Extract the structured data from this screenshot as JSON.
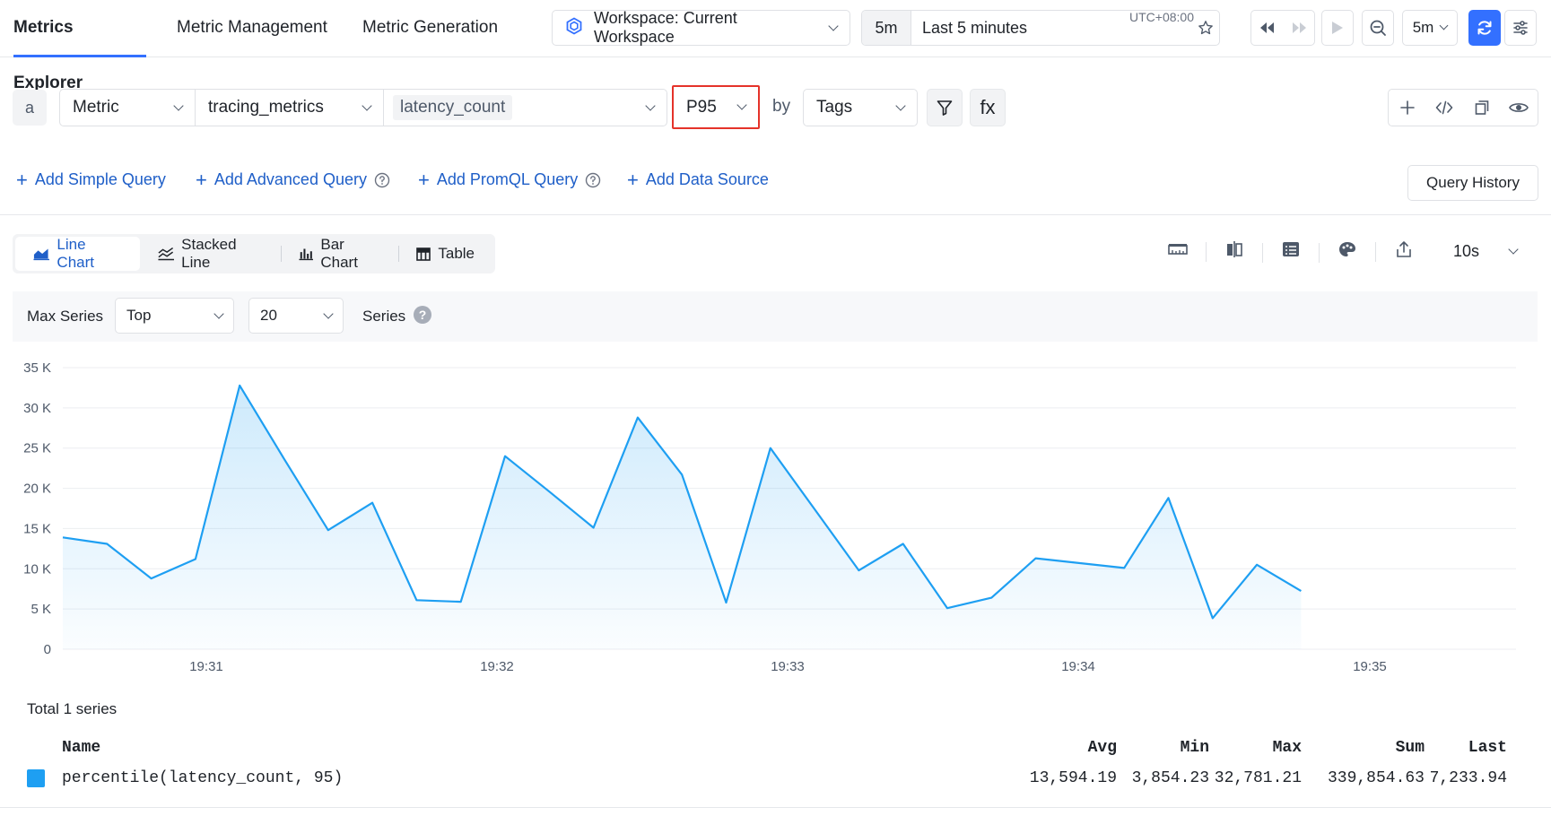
{
  "nav": {
    "tabs": [
      "Metrics Explorer",
      "Metric Management",
      "Metric Generation"
    ],
    "active_tab": "Metrics Explorer"
  },
  "toolbar": {
    "workspace_label": "Workspace: Current Workspace",
    "time_preset": "5m",
    "time_range": "Last 5 minutes",
    "timezone": "UTC+08:00",
    "refresh_interval": "5m",
    "accent_color": "#3370ff"
  },
  "query": {
    "letter": "a",
    "source_type": "Metric",
    "metric_group": "tracing_metrics",
    "metric_name": "latency_count",
    "aggregation": "P95",
    "by_label": "by",
    "group_by": "Tags",
    "fx_label": "fx",
    "highlight_color": "#e5332a"
  },
  "add_links": {
    "simple": "Add Simple Query",
    "advanced": "Add Advanced Query",
    "promql": "Add PromQL Query",
    "datasource": "Add Data Source",
    "history": "Query History"
  },
  "chart_types": {
    "line": "Line Chart",
    "stacked": "Stacked Line",
    "bar": "Bar Chart",
    "table": "Table",
    "active": "Line Chart"
  },
  "step": "10s",
  "options": {
    "max_series_label": "Max Series",
    "order": "Top",
    "limit": "20",
    "series_label": "Series"
  },
  "chart_data": {
    "type": "area",
    "series": [
      {
        "name": "percentile(latency_count, 95)",
        "color": "#1e9ff2",
        "values": [
          13900,
          13100,
          8800,
          11200,
          32781.21,
          23700,
          14800,
          18200,
          6100,
          5900,
          24000,
          19600,
          15100,
          28800,
          21700,
          5800,
          25000,
          17400,
          9800,
          13100,
          5100,
          6400,
          11300,
          10700,
          10100,
          18800,
          3854.23,
          10500,
          7233.94
        ]
      }
    ],
    "x_tick_labels": [
      "19:31",
      "19:32",
      "19:33",
      "19:34",
      "19:35"
    ],
    "y_tick_labels": [
      "35 K",
      "30 K",
      "25 K",
      "20 K",
      "15 K",
      "10 K",
      "5 K",
      "0"
    ],
    "ylim": [
      0,
      35000
    ],
    "grid": true
  },
  "legend": {
    "total": "Total 1 series",
    "headers": {
      "name": "Name",
      "avg": "Avg",
      "min": "Min",
      "max": "Max",
      "sum": "Sum",
      "last": "Last"
    },
    "rows": [
      {
        "name": "percentile(latency_count, 95)",
        "avg": "13,594.19",
        "min": "3,854.23",
        "max": "32,781.21",
        "sum": "339,854.63",
        "last": "7,233.94"
      }
    ]
  }
}
